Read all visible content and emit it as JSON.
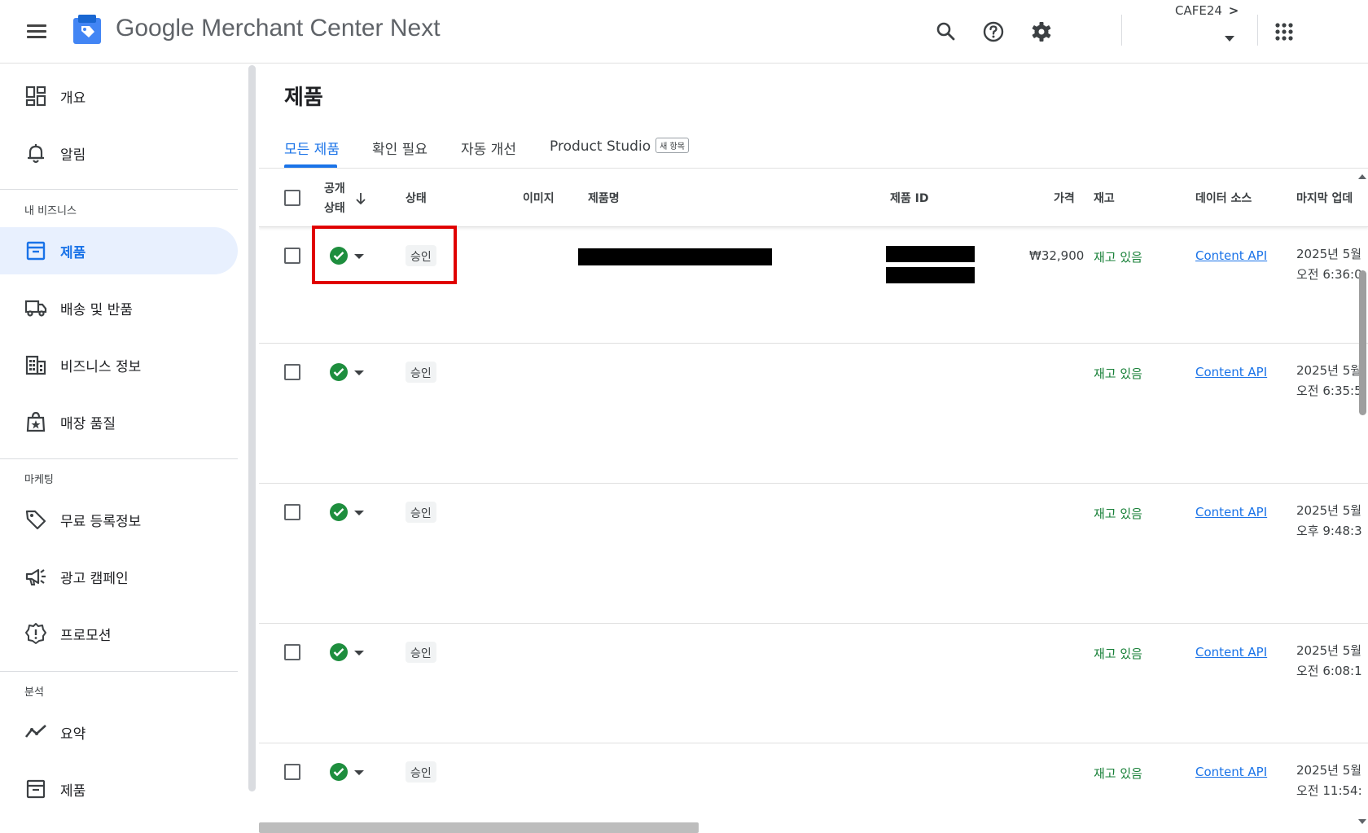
{
  "header": {
    "title_google": "Google",
    "title_rest": "Merchant Center Next",
    "account_name": "CAFE24",
    "account_chevron": ">",
    "icons": [
      "menu-icon",
      "search-icon",
      "help-icon",
      "settings-icon",
      "apps-icon"
    ]
  },
  "sidebar": {
    "items_top": [
      {
        "label": "개요",
        "icon": "dashboard-icon"
      },
      {
        "label": "알림",
        "icon": "bell-icon"
      }
    ],
    "sections": [
      {
        "title": "내 비즈니스",
        "items": [
          {
            "label": "제품",
            "icon": "product-box-icon",
            "active": true
          },
          {
            "label": "배송 및 반품",
            "icon": "truck-icon"
          },
          {
            "label": "비즈니스 정보",
            "icon": "building-icon"
          },
          {
            "label": "매장 품질",
            "icon": "store-quality-icon"
          }
        ]
      },
      {
        "title": "마케팅",
        "items": [
          {
            "label": "무료 등록정보",
            "icon": "tag-icon"
          },
          {
            "label": "광고 캠페인",
            "icon": "megaphone-icon"
          },
          {
            "label": "프로모션",
            "icon": "promotion-icon"
          }
        ]
      },
      {
        "title": "분석",
        "items": [
          {
            "label": "요약",
            "icon": "trend-icon"
          },
          {
            "label": "제품",
            "icon": "product-box-icon"
          }
        ]
      }
    ]
  },
  "main": {
    "page_title": "제품",
    "tabs": [
      {
        "label": "모든 제품",
        "active": true
      },
      {
        "label": "확인 필요"
      },
      {
        "label": "자동 개선"
      },
      {
        "label": "Product Studio",
        "badge": "새 항목"
      }
    ],
    "columns": {
      "visibility_line1": "공개",
      "visibility_line2": "상태",
      "status": "상태",
      "image": "이미지",
      "name": "제품명",
      "id": "제품 ID",
      "price": "가격",
      "stock": "재고",
      "source": "데이터 소스",
      "last_update": "마지막 업데"
    },
    "rows": [
      {
        "status": "승인",
        "price": "₩32,900",
        "stock": "재고 있음",
        "source": "Content API",
        "date_line1": "2025년 5월",
        "date_line2": "오전 6:36:0"
      },
      {
        "status": "승인",
        "price": "",
        "stock": "재고 있음",
        "source": "Content API",
        "date_line1": "2025년 5월",
        "date_line2": "오전 6:35:5"
      },
      {
        "status": "승인",
        "price": "",
        "stock": "재고 있음",
        "source": "Content API",
        "date_line1": "2025년 5월",
        "date_line2": "오후 9:48:3"
      },
      {
        "status": "승인",
        "price": "",
        "stock": "재고 있음",
        "source": "Content API",
        "date_line1": "2025년 5월",
        "date_line2": "오전 6:08:1"
      },
      {
        "status": "승인",
        "price": "",
        "stock": "재고 있음",
        "source": "Content API",
        "date_line1": "2025년 5월",
        "date_line2": "오전 11:54:"
      }
    ]
  },
  "colors": {
    "accent": "#1a73e8",
    "active_bg": "#e8f0fe",
    "ok_green": "#1e8e3e",
    "stock_green": "#188038",
    "highlight_red": "#e00000"
  }
}
